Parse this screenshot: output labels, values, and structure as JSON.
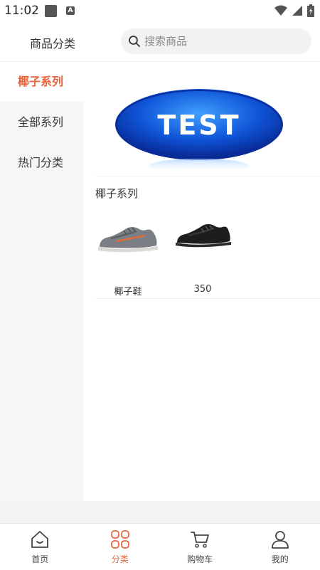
{
  "status_bar": {
    "time": "11:02"
  },
  "header": {
    "title": "商品分类",
    "search_placeholder": "搜索商品"
  },
  "sidebar": {
    "items": [
      {
        "label": "椰子系列",
        "active": true
      },
      {
        "label": "全部系列",
        "active": false
      },
      {
        "label": "热门分类",
        "active": false
      }
    ]
  },
  "content": {
    "banner_text": "TEST",
    "section_title": "椰子系列",
    "products": [
      {
        "name": "椰子鞋",
        "image": "gray-sneaker"
      },
      {
        "name": "350",
        "image": "black-sneaker"
      }
    ]
  },
  "tabbar": {
    "items": [
      {
        "label": "首页",
        "icon": "home-icon",
        "active": false
      },
      {
        "label": "分类",
        "icon": "category-icon",
        "active": true
      },
      {
        "label": "购物车",
        "icon": "cart-icon",
        "active": false
      },
      {
        "label": "我的",
        "icon": "user-icon",
        "active": false
      }
    ]
  },
  "colors": {
    "accent": "#e8643c",
    "sidebar_bg": "#f6f6f6",
    "search_bg": "#f2f2f2"
  }
}
